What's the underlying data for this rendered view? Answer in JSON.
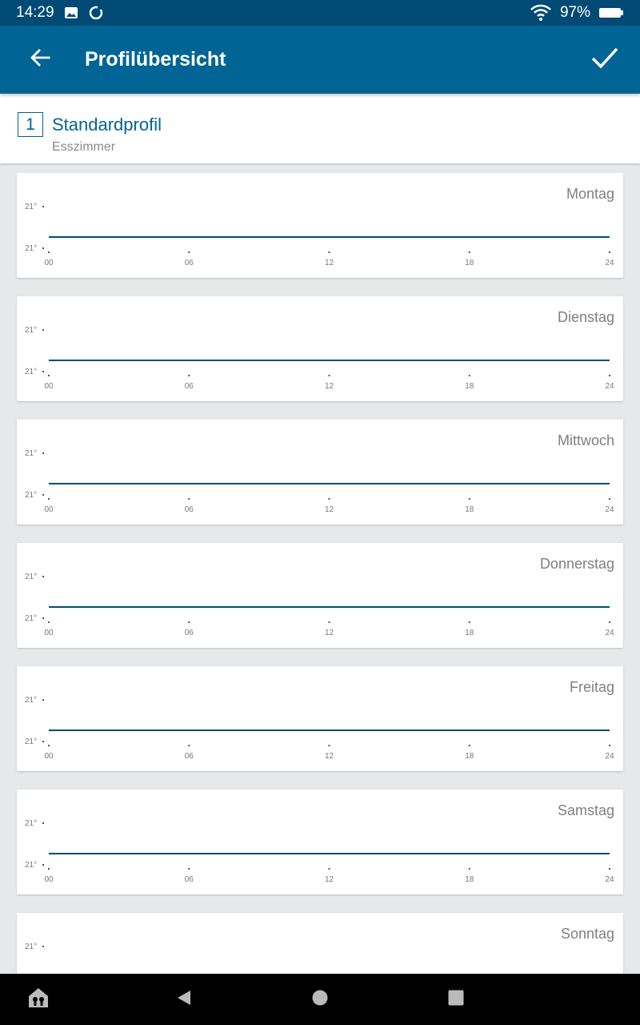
{
  "status_bar": {
    "time": "14:29",
    "battery": "97%",
    "icons": [
      "image-icon",
      "sync-icon",
      "wifi-icon",
      "battery-icon"
    ]
  },
  "app_bar": {
    "title": "Profilübersicht",
    "back_icon": "arrow-left-icon",
    "confirm_icon": "checkmark-icon"
  },
  "profile": {
    "number": "1",
    "name": "Standardprofil",
    "room": "Esszimmer"
  },
  "chart_defaults": {
    "y_top_label": "21°",
    "y_bottom_label": "21°",
    "x_ticks": [
      "00",
      "06",
      "12",
      "18",
      "24"
    ]
  },
  "days": [
    {
      "name": "Montag",
      "chart_data": {
        "type": "line",
        "x": [
          0,
          24
        ],
        "y": [
          21,
          21
        ],
        "xlim": [
          0,
          24
        ]
      }
    },
    {
      "name": "Dienstag",
      "chart_data": {
        "type": "line",
        "x": [
          0,
          24
        ],
        "y": [
          21,
          21
        ],
        "xlim": [
          0,
          24
        ]
      }
    },
    {
      "name": "Mittwoch",
      "chart_data": {
        "type": "line",
        "x": [
          0,
          24
        ],
        "y": [
          21,
          21
        ],
        "xlim": [
          0,
          24
        ]
      }
    },
    {
      "name": "Donnerstag",
      "chart_data": {
        "type": "line",
        "x": [
          0,
          24
        ],
        "y": [
          21,
          21
        ],
        "xlim": [
          0,
          24
        ]
      }
    },
    {
      "name": "Freitag",
      "chart_data": {
        "type": "line",
        "x": [
          0,
          24
        ],
        "y": [
          21,
          21
        ],
        "xlim": [
          0,
          24
        ]
      }
    },
    {
      "name": "Samstag",
      "chart_data": {
        "type": "line",
        "x": [
          0,
          24
        ],
        "y": [
          21,
          21
        ],
        "xlim": [
          0,
          24
        ]
      }
    },
    {
      "name": "Sonntag",
      "chart_data": {
        "type": "line",
        "x": [
          0,
          24
        ],
        "y": [
          21,
          21
        ],
        "xlim": [
          0,
          24
        ]
      }
    }
  ],
  "nav_bar": {
    "items": [
      "home-app-icon",
      "back-triangle-icon",
      "home-circle-icon",
      "recents-square-icon"
    ]
  },
  "colors": {
    "primary": "#006495",
    "status_bar": "#004a75",
    "line": "#004d6e",
    "background": "#e6e8ea"
  }
}
